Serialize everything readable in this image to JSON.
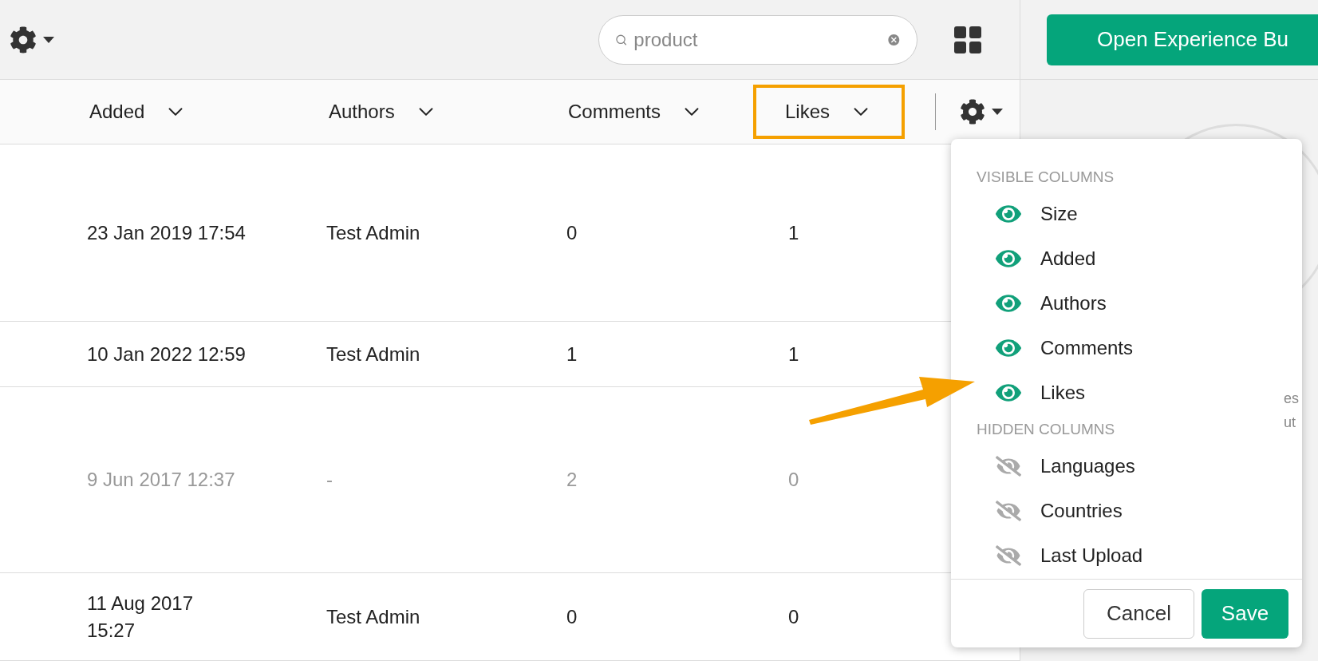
{
  "toolbar": {
    "search": {
      "value": "product"
    },
    "primary_button": "Open Experience Bu"
  },
  "columns": [
    {
      "label": "Added",
      "highlighted": false
    },
    {
      "label": "Authors",
      "highlighted": false
    },
    {
      "label": "Comments",
      "highlighted": false
    },
    {
      "label": "Likes",
      "highlighted": true
    }
  ],
  "rows": [
    {
      "added": [
        "23 Jan 2019 17:54"
      ],
      "authors": "Test Admin",
      "comments": "0",
      "likes": "1",
      "greyed": false
    },
    {
      "added": [
        "10 Jan 2022 12:59"
      ],
      "authors": "Test Admin",
      "comments": "1",
      "likes": "1",
      "greyed": false
    },
    {
      "added": [
        "9 Jun 2017 12:37"
      ],
      "authors": "-",
      "comments": "2",
      "likes": "0",
      "greyed": true
    },
    {
      "added": [
        "11 Aug 2017",
        "15:27"
      ],
      "authors": "Test Admin",
      "comments": "0",
      "likes": "0",
      "greyed": false
    }
  ],
  "column_menu": {
    "sections": [
      {
        "title": "VISIBLE COLUMNS",
        "items": [
          {
            "label": "Size",
            "visible": true
          },
          {
            "label": "Added",
            "visible": true
          },
          {
            "label": "Authors",
            "visible": true
          },
          {
            "label": "Comments",
            "visible": true
          },
          {
            "label": "Likes",
            "visible": true
          }
        ]
      },
      {
        "title": "HIDDEN COLUMNS",
        "items": [
          {
            "label": "Languages",
            "visible": false
          },
          {
            "label": "Countries",
            "visible": false
          },
          {
            "label": "Last Upload",
            "visible": false
          }
        ]
      }
    ],
    "cancel": "Cancel",
    "save": "Save"
  },
  "side_panel": {
    "partial_text": [
      "es",
      "ut"
    ]
  }
}
